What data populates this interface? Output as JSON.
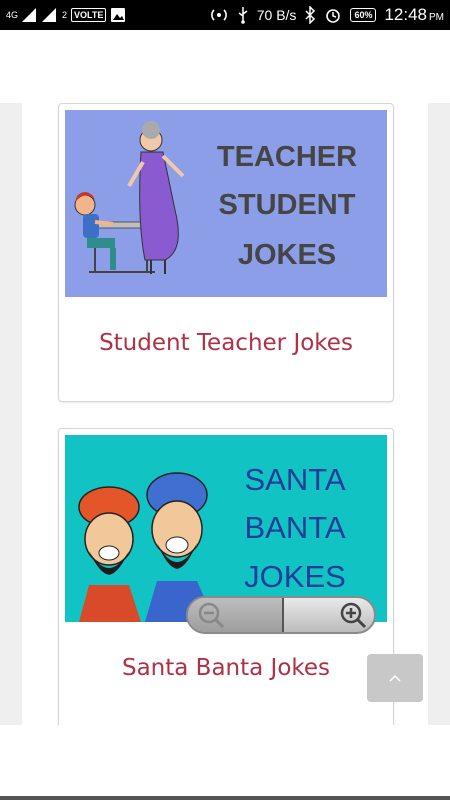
{
  "status_bar": {
    "network": "4G",
    "sim_slot": "2",
    "volte": "VOLTE",
    "speed": "70 B/s",
    "battery": "60%",
    "time": "12:48",
    "ampm": "PM",
    "icons": [
      "signal-icon",
      "signal-2-icon",
      "image-icon",
      "hotspot-icon",
      "usb-icon",
      "bluetooth-icon",
      "alarm-icon",
      "battery-icon"
    ]
  },
  "cards": [
    {
      "image_text_lines": [
        "TEACHER",
        "STUDENT",
        "JOKES"
      ],
      "title": "Student Teacher Jokes",
      "bg_color": "#8c9ee8"
    },
    {
      "image_text_lines": [
        "SANTA",
        "BANTA",
        "JOKES"
      ],
      "title": "Santa Banta Jokes",
      "bg_color": "#12c3c3"
    }
  ],
  "colors": {
    "title_text": "#b03046",
    "teacher_text": "#454545",
    "santa_text": "#1d3f9a"
  },
  "zoom_controls": [
    "zoom-out-icon",
    "zoom-in-icon"
  ],
  "scroll_top_icon": "chevron-up-icon"
}
